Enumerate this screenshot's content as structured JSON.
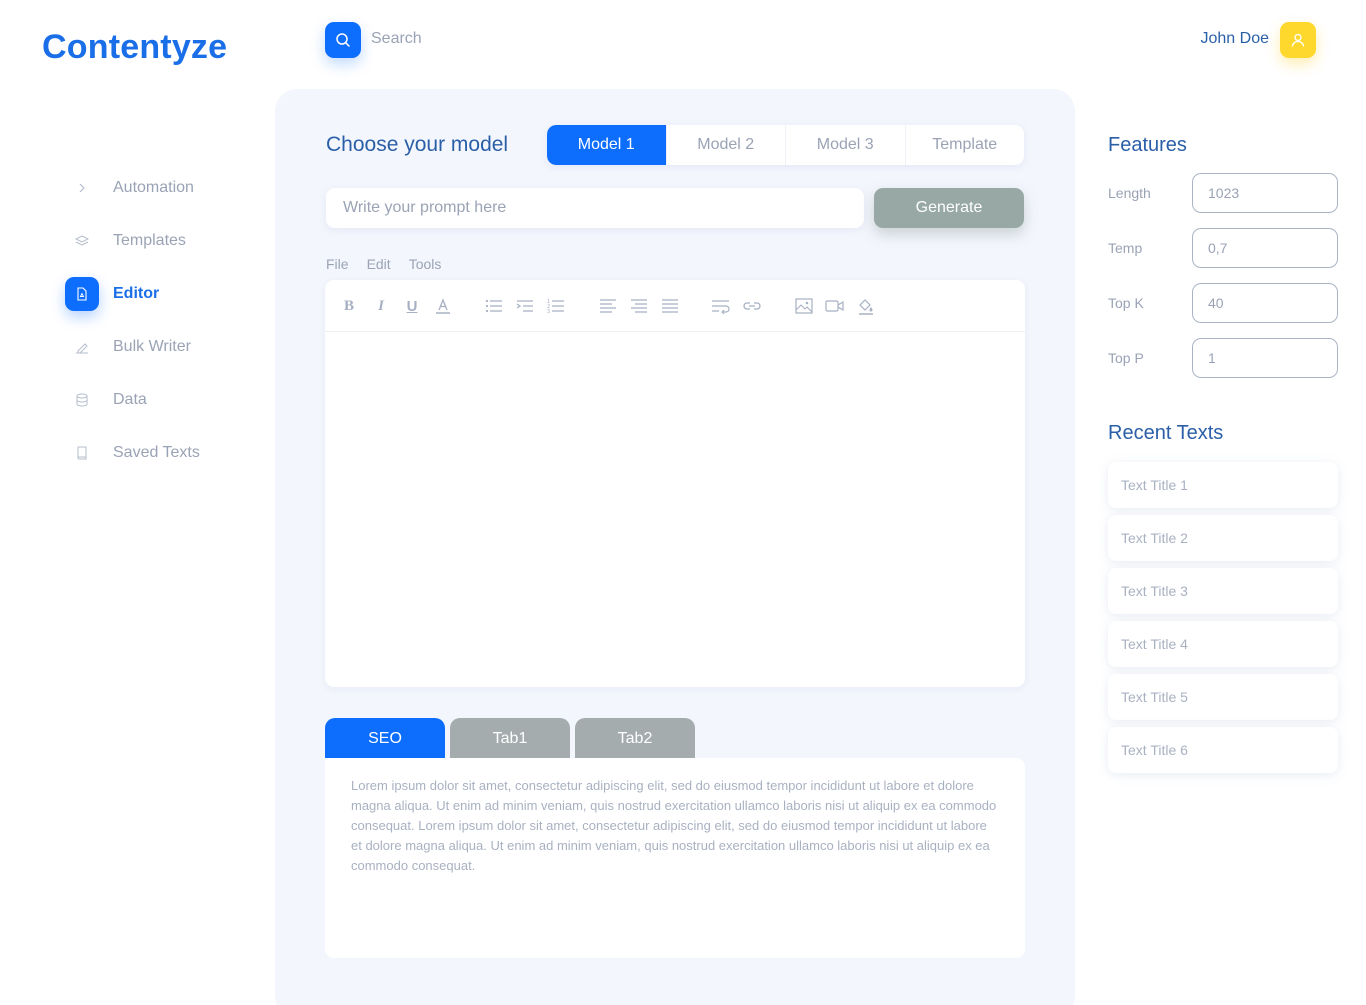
{
  "brand": "Contentyze",
  "header": {
    "search_placeholder": "Search",
    "user_name": "John Doe"
  },
  "sidebar": {
    "items": [
      {
        "label": "Automation",
        "icon": "chevron-right-icon"
      },
      {
        "label": "Templates",
        "icon": "layers-icon"
      },
      {
        "label": "Editor",
        "icon": "document-icon",
        "active": true
      },
      {
        "label": "Bulk Writer",
        "icon": "pen-icon"
      },
      {
        "label": "Data",
        "icon": "database-icon"
      },
      {
        "label": "Saved Texts",
        "icon": "book-icon"
      }
    ]
  },
  "main": {
    "choose_title": "Choose your model",
    "model_tabs": [
      "Model 1",
      "Model 2",
      "Model 3",
      "Template"
    ],
    "prompt_placeholder": "Write your prompt here",
    "generate_label": "Generate",
    "menu": [
      "File",
      "Edit",
      "Tools"
    ],
    "bottom_tabs": [
      "SEO",
      "Tab1",
      "Tab2"
    ],
    "seo_text": "Lorem ipsum dolor sit amet, consectetur adipiscing elit, sed do eiusmod tempor incididunt ut labore et dolore magna aliqua. Ut enim ad minim veniam, quis nostrud exercitation ullamco laboris nisi ut aliquip ex ea commodo consequat. Lorem ipsum dolor sit amet, consectetur adipiscing elit, sed do eiusmod tempor incididunt ut labore et dolore magna aliqua. Ut enim ad minim veniam, quis nostrud exercitation ullamco laboris nisi ut aliquip ex ea commodo consequat."
  },
  "features": {
    "title": "Features",
    "fields": [
      {
        "label": "Length",
        "value": "1023"
      },
      {
        "label": "Temp",
        "value": "0,7"
      },
      {
        "label": "Top K",
        "value": "40"
      },
      {
        "label": "Top P",
        "value": "1"
      }
    ]
  },
  "recent": {
    "title": "Recent Texts",
    "items": [
      "Text Title 1",
      "Text Title 2",
      "Text Title 3",
      "Text Title 4",
      "Text Title 5",
      "Text Title 6"
    ]
  },
  "colors": {
    "accent": "#0d6efd",
    "brand": "#1a6fe8",
    "heading": "#2a5fa8",
    "avatar": "#ffd82e",
    "generate": "#97a8a5"
  }
}
